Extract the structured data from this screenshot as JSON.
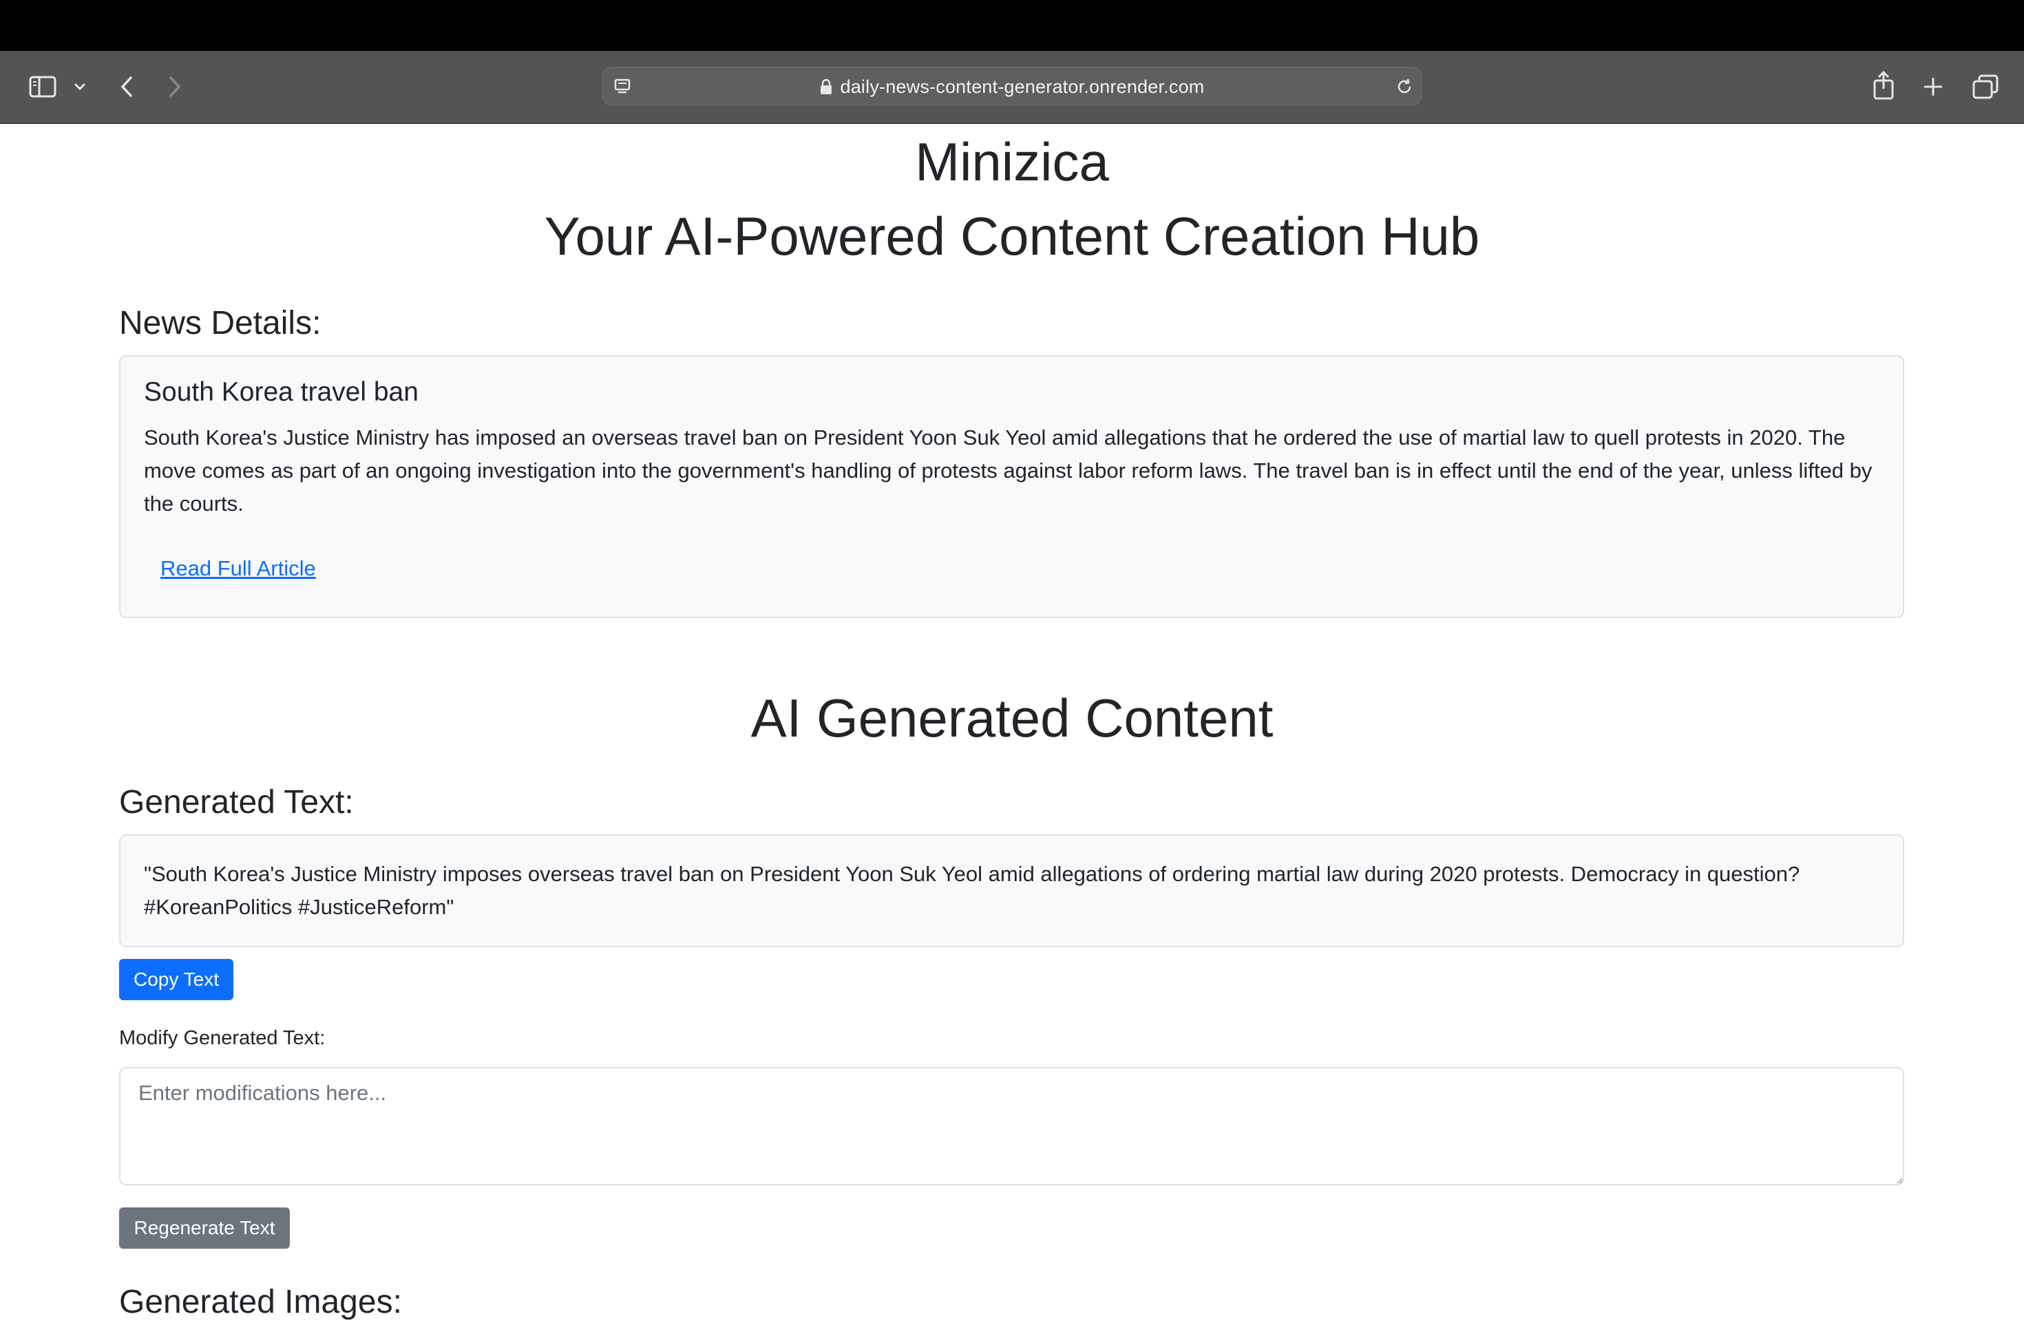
{
  "browser": {
    "url": "daily-news-content-generator.onrender.com"
  },
  "header": {
    "brand": "Minizica",
    "tagline": "Your AI-Powered Content Creation Hub"
  },
  "news": {
    "section_title": "News Details:",
    "title": "South Korea travel ban",
    "description": "South Korea's Justice Ministry has imposed an overseas travel ban on President Yoon Suk Yeol amid allegations that he ordered the use of martial law to quell protests in 2020. The move comes as part of an ongoing investigation into the government's handling of protests against labor reform laws. The travel ban is in effect until the end of the year, unless lifted by the courts.",
    "link_label": "Read Full Article"
  },
  "ai": {
    "heading": "AI Generated Content",
    "text_section_title": "Generated Text:",
    "generated_text": "\"South Korea's Justice Ministry imposes overseas travel ban on President Yoon Suk Yeol amid allegations of ordering martial law during 2020 protests. Democracy in question? #KoreanPolitics #JusticeReform\"",
    "copy_button": "Copy Text",
    "modify_label": "Modify Generated Text:",
    "modify_placeholder": "Enter modifications here...",
    "regenerate_button": "Regenerate Text",
    "images_section_title": "Generated Images:"
  },
  "colors": {
    "primary": "#0d6efd",
    "secondary": "#6c757d",
    "card_bg": "#f8f9fa"
  }
}
